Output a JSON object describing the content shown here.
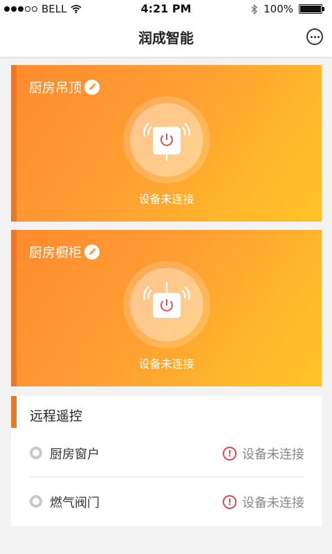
{
  "status_bar": {
    "carrier": "BELL",
    "time": "4:21 PM",
    "battery": "100%",
    "battery_level": 1.0
  },
  "nav": {
    "title": "润成智能"
  },
  "cards": [
    {
      "title": "厨房吊顶",
      "status": "设备未连接"
    },
    {
      "title": "厨房橱柜",
      "status": "设备未连接"
    }
  ],
  "remote": {
    "title": "远程遥控",
    "items": [
      {
        "name": "厨房窗户",
        "status": "设备未连接"
      },
      {
        "name": "燃气阀门",
        "status": "设备未连接"
      }
    ]
  },
  "colors": {
    "accent": "#e9792a",
    "card_gradient_start": "#ff8a2e",
    "card_gradient_end": "#ffc228",
    "power_red": "#e05050",
    "warn_red": "#e04a4a"
  },
  "icons": [
    "signal-dots-icon",
    "wifi-icon",
    "bluetooth-icon",
    "battery-icon",
    "more-icon",
    "edit-icon",
    "power-icon",
    "wifi-wave-icon",
    "radio-icon",
    "warning-icon"
  ]
}
